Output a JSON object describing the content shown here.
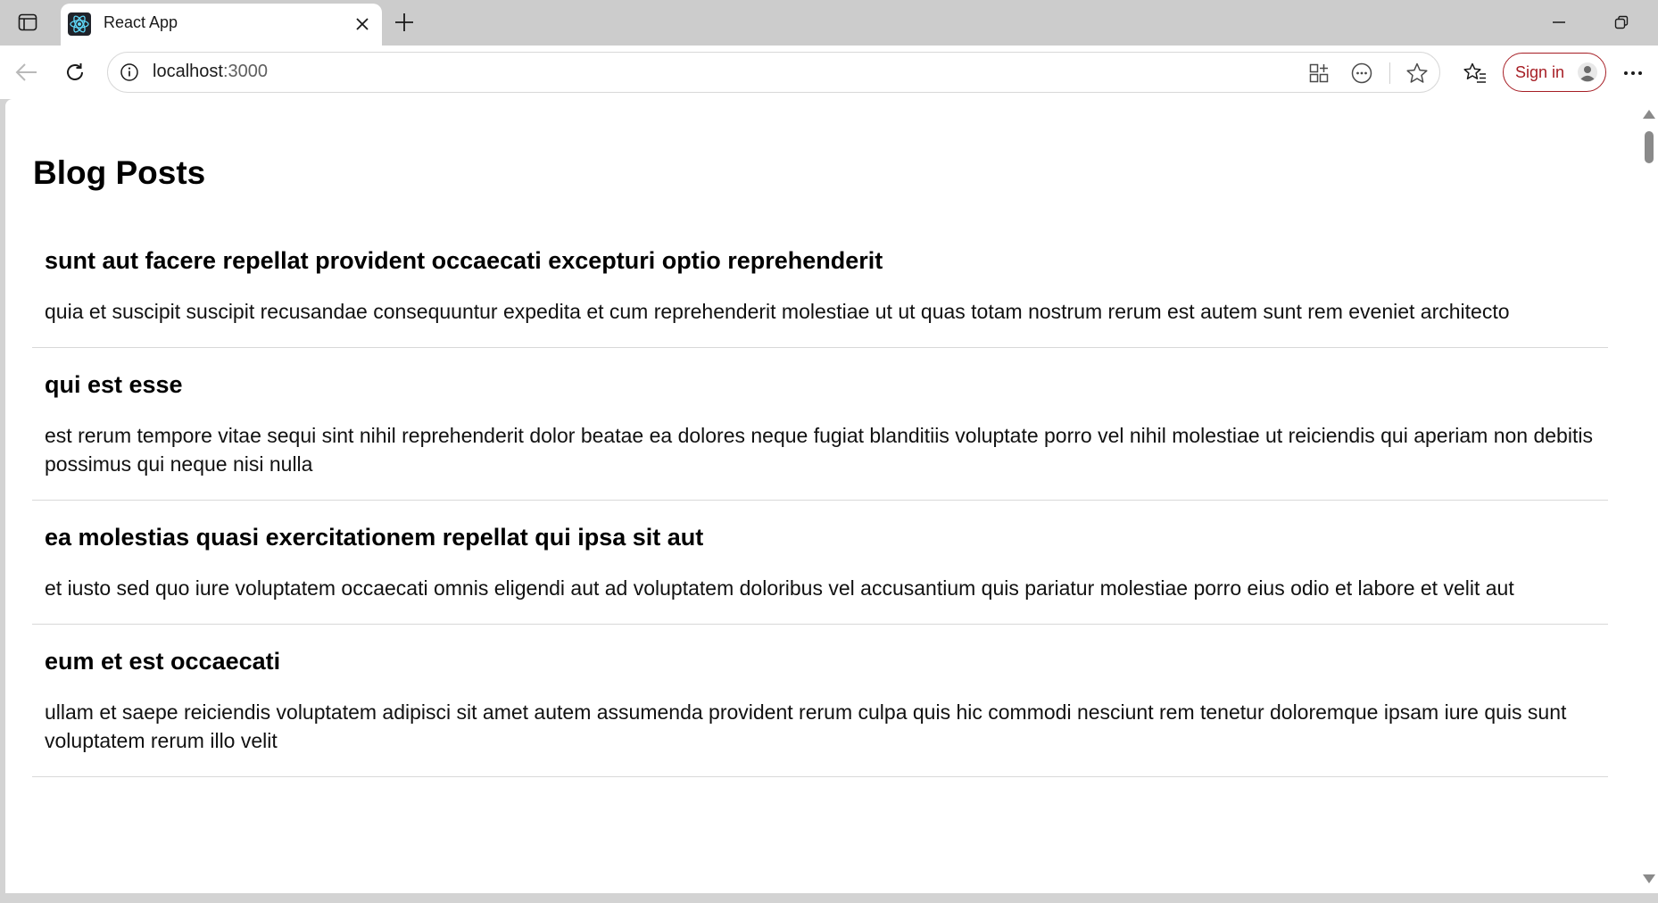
{
  "browser": {
    "tab": {
      "title": "React App",
      "favicon": "react-logo-icon"
    },
    "address": {
      "host": "localhost",
      "port": ":3000"
    },
    "signin_label": "Sign in"
  },
  "page": {
    "heading": "Blog Posts",
    "posts": [
      {
        "title": "sunt aut facere repellat provident occaecati excepturi optio reprehenderit",
        "body": "quia et suscipit suscipit recusandae consequuntur expedita et cum reprehenderit molestiae ut ut quas totam nostrum rerum est autem sunt rem eveniet architecto"
      },
      {
        "title": "qui est esse",
        "body": "est rerum tempore vitae sequi sint nihil reprehenderit dolor beatae ea dolores neque fugiat blanditiis voluptate porro vel nihil molestiae ut reiciendis qui aperiam non debitis possimus qui neque nisi nulla"
      },
      {
        "title": "ea molestias quasi exercitationem repellat qui ipsa sit aut",
        "body": "et iusto sed quo iure voluptatem occaecati omnis eligendi aut ad voluptatem doloribus vel accusantium quis pariatur molestiae porro eius odio et labore et velit aut"
      },
      {
        "title": "eum et est occaecati",
        "body": "ullam et saepe reiciendis voluptatem adipisci sit amet autem assumenda provident rerum culpa quis hic commodi nesciunt rem tenetur doloremque ipsam iure quis sunt voluptatem rerum illo velit"
      }
    ]
  },
  "colors": {
    "signin_accent": "#a61d24",
    "react_logo": "#61dafb"
  }
}
